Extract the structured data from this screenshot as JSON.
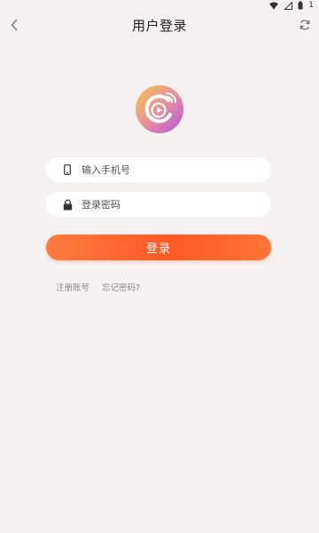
{
  "statusbar": {
    "battery_text": "1"
  },
  "header": {
    "title": "用户登录"
  },
  "form": {
    "phone_placeholder": "输入手机号",
    "password_placeholder": "登录密码",
    "login_label": "登录"
  },
  "links": {
    "register": "注册账号",
    "forgot_password": "忘记密码?"
  },
  "colors": {
    "background": "#f5f1f0",
    "accent": "#ff5a22",
    "logo_gradient_start": "#f6c254",
    "logo_gradient_end": "#b25bd8"
  },
  "icons": {
    "back": "chevron-left-icon",
    "refresh": "refresh-icon",
    "phone": "phone-icon",
    "lock": "lock-icon",
    "wifi": "wifi-icon",
    "signal": "signal-icon",
    "logo": "play-logo-icon"
  }
}
